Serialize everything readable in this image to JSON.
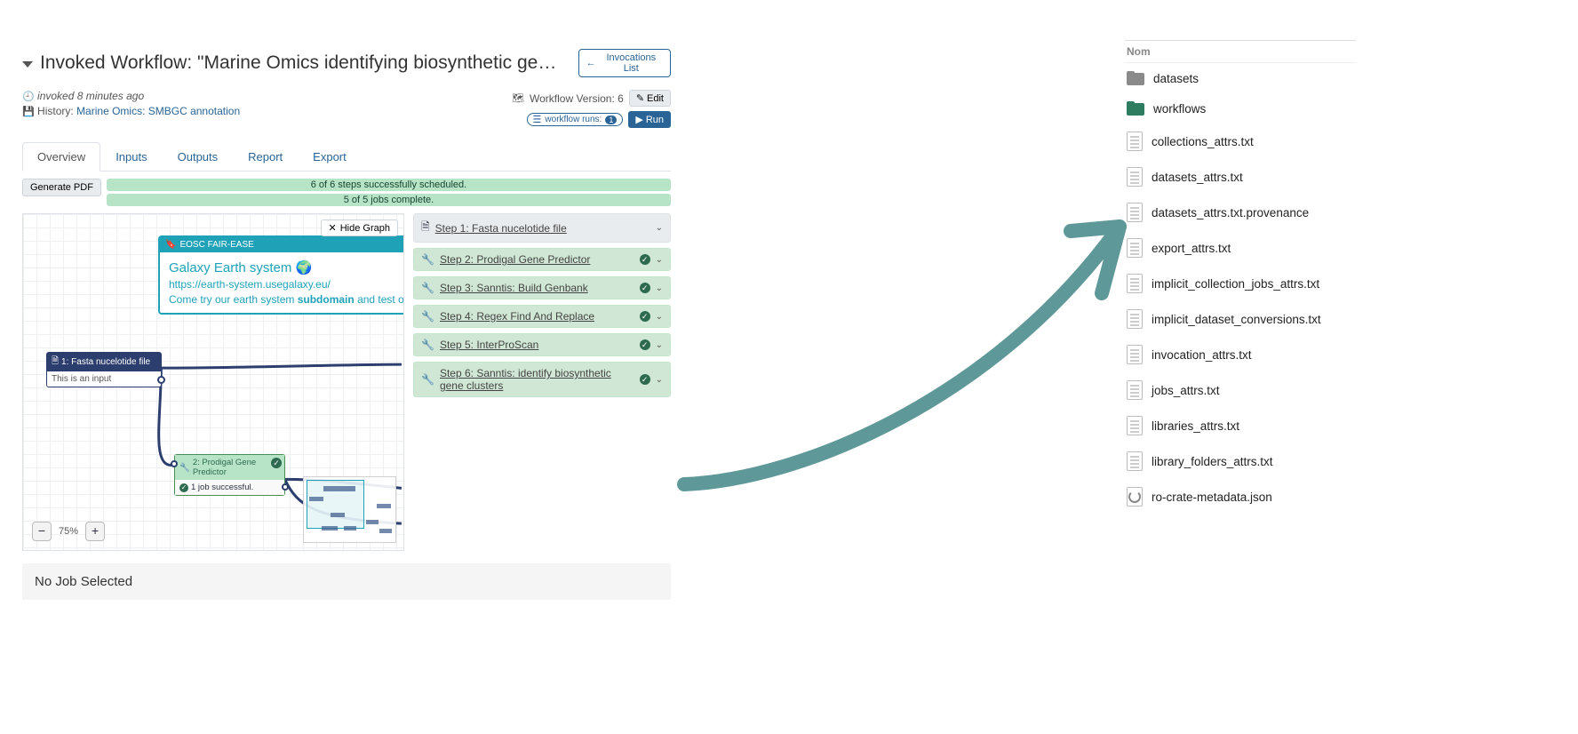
{
  "header": {
    "title": "Invoked Workflow: \"Marine Omics identifying biosynthetic gene cl...",
    "invocations_list": "Invocations List",
    "invoked_ago": "invoked 8 minutes ago",
    "history_label": "History:",
    "history_link": "Marine Omics: SMBGC annotation",
    "version_label": "Workflow Version: 6",
    "workflow_runs_label": "workflow runs:",
    "workflow_runs_count": "1",
    "edit": "Edit",
    "run": "Run"
  },
  "tabs": [
    "Overview",
    "Inputs",
    "Outputs",
    "Report",
    "Export"
  ],
  "active_tab": 0,
  "generate_pdf": "Generate PDF",
  "progress": {
    "line1": "6 of 6 steps successfully scheduled.",
    "line2": "5 of 5 jobs complete."
  },
  "graph": {
    "hide_graph": "Hide Graph",
    "eosc_tag": "EOSC FAIR-EASE",
    "eosc_title": "Galaxy Earth system 🌍",
    "eosc_url": "https://earth-system.usegalaxy.eu/",
    "eosc_desc_pre": "Come try our earth system ",
    "eosc_desc_bold": "subdomain",
    "eosc_desc_post": " and test ou",
    "node1_title": "1: Fasta nucelotide file",
    "node1_body": "This is an input",
    "node2_title": "2: Prodigal Gene Predictor",
    "node2_status": "1 job successful.",
    "zoom_level": "75%"
  },
  "steps": [
    {
      "label": "Step 1: Fasta nucelotide file",
      "kind": "file"
    },
    {
      "label": "Step 2: Prodigal Gene Predictor",
      "kind": "tool"
    },
    {
      "label": "Step 3: Sanntis: Build Genbank",
      "kind": "tool"
    },
    {
      "label": "Step 4: Regex Find And Replace",
      "kind": "tool"
    },
    {
      "label": "Step 5: InterProScan",
      "kind": "tool"
    },
    {
      "label": "Step 6: Sanntis: identify biosynthetic gene clusters",
      "kind": "tool"
    }
  ],
  "no_job": "No Job Selected",
  "file_panel": {
    "header": "Nom",
    "items": [
      {
        "name": "datasets",
        "type": "folder-grey"
      },
      {
        "name": "workflows",
        "type": "folder-green"
      },
      {
        "name": "collections_attrs.txt",
        "type": "txt"
      },
      {
        "name": "datasets_attrs.txt",
        "type": "txt"
      },
      {
        "name": "datasets_attrs.txt.provenance",
        "type": "txt"
      },
      {
        "name": "export_attrs.txt",
        "type": "txt"
      },
      {
        "name": "implicit_collection_jobs_attrs.txt",
        "type": "txt"
      },
      {
        "name": "implicit_dataset_conversions.txt",
        "type": "txt"
      },
      {
        "name": "invocation_attrs.txt",
        "type": "txt"
      },
      {
        "name": "jobs_attrs.txt",
        "type": "txt"
      },
      {
        "name": "libraries_attrs.txt",
        "type": "txt"
      },
      {
        "name": "library_folders_attrs.txt",
        "type": "txt"
      },
      {
        "name": "ro-crate-metadata.json",
        "type": "json"
      }
    ]
  }
}
